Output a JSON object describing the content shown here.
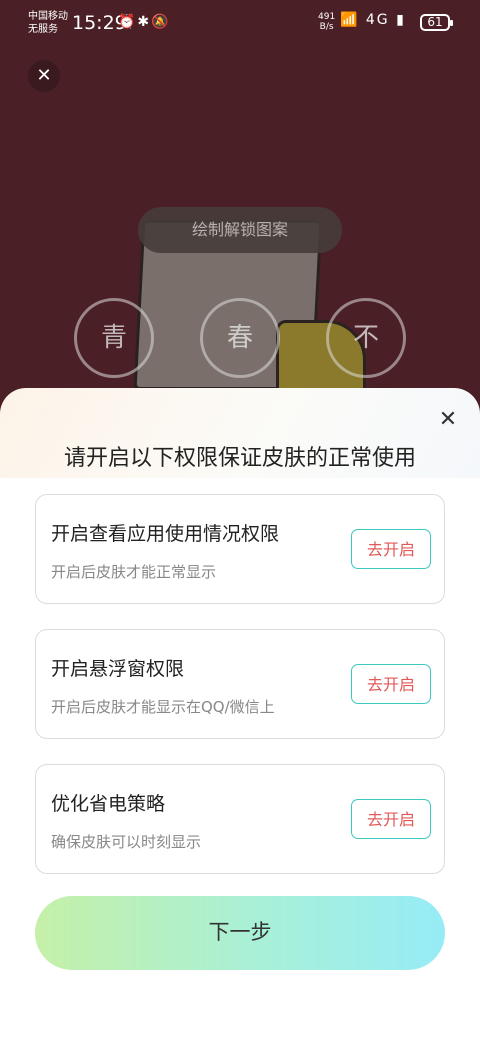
{
  "status_bar": {
    "carrier_line1": "中国移动",
    "carrier_line2": "无服务",
    "time": "15:29",
    "left_icons": "⏰✱🔕",
    "net_speed_value": "491",
    "net_speed_unit": "B/s",
    "right_icons": "📶 4G ▮",
    "battery": "61"
  },
  "background": {
    "close_icon": "✕",
    "pattern_hint": "绘制解锁图案",
    "dots": [
      "青",
      "春",
      "不"
    ]
  },
  "sheet": {
    "close_icon": "✕",
    "title": "请开启以下权限保证皮肤的正常使用",
    "permissions": [
      {
        "title": "开启查看应用使用情况权限",
        "desc": "开启后皮肤才能正常显示",
        "button": "去开启"
      },
      {
        "title": "开启悬浮窗权限",
        "desc": "开启后皮肤才能显示在QQ/微信上",
        "button": "去开启"
      },
      {
        "title": "优化省电策略",
        "desc": "确保皮肤可以时刻显示",
        "button": "去开启"
      }
    ],
    "next_button": "下一步"
  },
  "colors": {
    "background": "#4a2026",
    "button_border": "#3cc8c0",
    "button_text": "#e05a58",
    "next_gradient_start": "#c5f0a8",
    "next_gradient_end": "#96ecf6"
  }
}
